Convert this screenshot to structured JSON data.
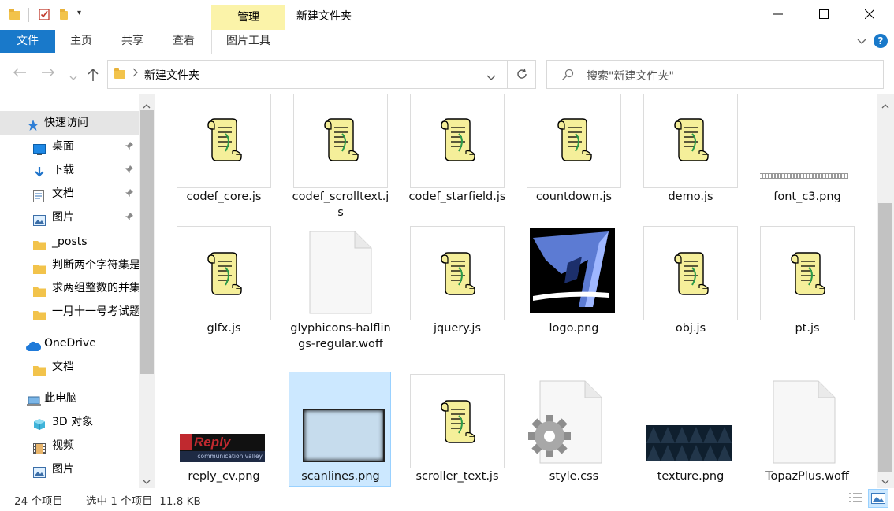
{
  "titlebar": {
    "manage_tab": "管理",
    "window_title": "新建文件夹",
    "minimize": "—",
    "maximize": "☐",
    "close": "✕"
  },
  "ribbon": {
    "tabs": [
      "文件",
      "主页",
      "共享",
      "查看",
      "图片工具"
    ]
  },
  "address": {
    "path": "新建文件夹",
    "search_placeholder": "搜索\"新建文件夹\""
  },
  "sidebar": {
    "items": [
      {
        "label": "快速访问",
        "icon": "star-icon",
        "pinned": false,
        "selected": true
      },
      {
        "label": "桌面",
        "icon": "desktop-icon",
        "pinned": true
      },
      {
        "label": "下载",
        "icon": "download-icon",
        "pinned": true
      },
      {
        "label": "文档",
        "icon": "document-icon",
        "pinned": true
      },
      {
        "label": "图片",
        "icon": "picture-icon",
        "pinned": true
      },
      {
        "label": "_posts",
        "icon": "folder-icon",
        "pinned": false
      },
      {
        "label": "判断两个字符集是",
        "icon": "folder-icon",
        "pinned": false
      },
      {
        "label": "求两组整数的并集",
        "icon": "folder-icon",
        "pinned": false
      },
      {
        "label": "一月十一号考试题",
        "icon": "folder-icon",
        "pinned": false
      },
      {
        "label": "OneDrive",
        "icon": "cloud-icon",
        "pinned": false
      },
      {
        "label": "文档",
        "icon": "folder-icon",
        "pinned": false
      },
      {
        "label": "此电脑",
        "icon": "computer-icon",
        "pinned": false
      },
      {
        "label": "3D 对象",
        "icon": "cube-icon",
        "pinned": false
      },
      {
        "label": "视频",
        "icon": "video-icon",
        "pinned": false
      },
      {
        "label": "图片",
        "icon": "picture-icon",
        "pinned": false
      }
    ]
  },
  "files": [
    {
      "name": "codef_core.js",
      "type": "js"
    },
    {
      "name": "codef_scrolltext.js",
      "type": "js"
    },
    {
      "name": "codef_starfield.js",
      "type": "js"
    },
    {
      "name": "countdown.js",
      "type": "js"
    },
    {
      "name": "demo.js",
      "type": "js"
    },
    {
      "name": "font_c3.png",
      "type": "font-strip"
    },
    {
      "name": "glfx.js",
      "type": "js"
    },
    {
      "name": "glyphicons-halflings-regular.woff",
      "type": "blank"
    },
    {
      "name": "jquery.js",
      "type": "js"
    },
    {
      "name": "logo.png",
      "type": "logo"
    },
    {
      "name": "obj.js",
      "type": "js"
    },
    {
      "name": "pt.js",
      "type": "js"
    },
    {
      "name": "reply_cv.png",
      "type": "reply"
    },
    {
      "name": "scanlines.png",
      "type": "scanlines",
      "selected": true
    },
    {
      "name": "scroller_text.js",
      "type": "js"
    },
    {
      "name": "style.css",
      "type": "css"
    },
    {
      "name": "texture.png",
      "type": "texture"
    },
    {
      "name": "TopazPlus.woff",
      "type": "blank"
    }
  ],
  "reply_logo": {
    "title": "Reply",
    "subtitle": "communication valley"
  },
  "status": {
    "item_count": "24 个项目",
    "selection": "选中 1 个项目  11.8 KB"
  },
  "colors": {
    "accent": "#1979ca",
    "manage_tab_bg": "#fbf3a9",
    "selection_bg": "#cce8ff",
    "selection_border": "#99d1ff",
    "sidebar_selected": "#e5e5e5"
  }
}
